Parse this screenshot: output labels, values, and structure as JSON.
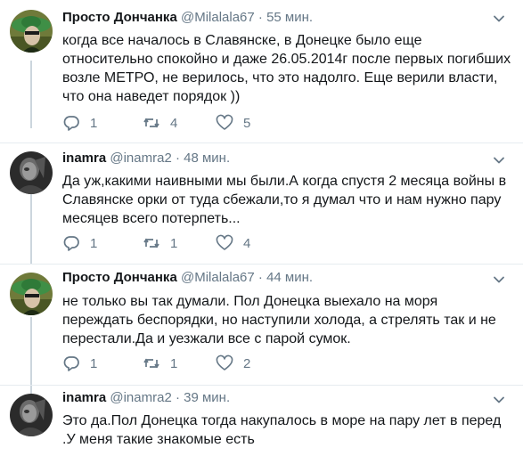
{
  "tweets": [
    {
      "name": "Просто Дончанка",
      "handle": "@Milalala67",
      "dot": "·",
      "time": "55 мин.",
      "text": "когда все началось в Славянске, в Донецке было еще относительно спокойно и даже 26.05.2014г после первых погибших возле МЕТРО, не верилось, что это надолго. Еще верили власти, что она наведет порядок ))",
      "replies": "1",
      "retweets": "4",
      "likes": "5",
      "avatar": "green-hat"
    },
    {
      "name": "inamra",
      "handle": "@inamra2",
      "dot": "·",
      "time": "48 мин.",
      "text": "Да уж,какими наивными мы были.А когда спустя 2 месяца войны в Славянске орки от туда сбежали,то я думал что и нам нужно пару месяцев всего потерпеть...",
      "replies": "1",
      "retweets": "1",
      "likes": "4",
      "avatar": "dark-portrait"
    },
    {
      "name": "Просто Дончанка",
      "handle": "@Milalala67",
      "dot": "·",
      "time": "44 мин.",
      "text": "не только вы так думали. Пол Донецка выехало на моря переждать беспорядки, но наступили холода, а стрелять так и не перестали.Да  и уезжали все с парой сумок.",
      "replies": "1",
      "retweets": "1",
      "likes": "2",
      "avatar": "green-hat"
    },
    {
      "name": "inamra",
      "handle": "@inamra2",
      "dot": "·",
      "time": "39 мин.",
      "text": "Это да.Пол Донецка тогда накупалось в море на пару лет в перед .У меня такие знакомые есть",
      "avatar": "dark-portrait"
    }
  ],
  "colors": {
    "text": "#14171a",
    "muted": "#657786",
    "divider": "#e6ecf0",
    "thread_line": "#ccd6dd"
  }
}
